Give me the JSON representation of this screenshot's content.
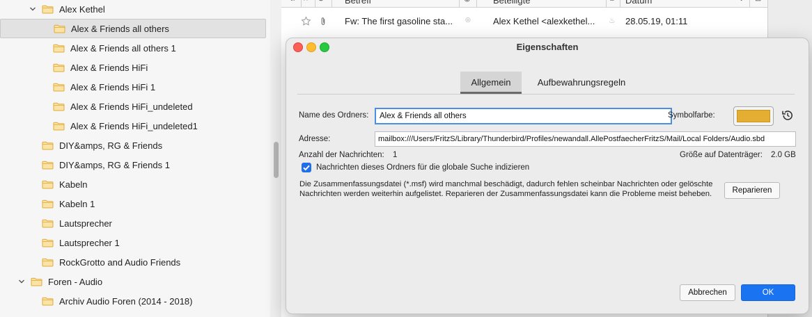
{
  "sidebar": {
    "items": [
      {
        "label": "Alex Kethel",
        "level": 1,
        "expanded": true,
        "selected": false
      },
      {
        "label": "Alex & Friends all others",
        "level": 2,
        "selected": true
      },
      {
        "label": "Alex & Friends all others 1",
        "level": 2
      },
      {
        "label": "Alex & Friends HiFi",
        "level": 2
      },
      {
        "label": "Alex & Friends HiFi 1",
        "level": 2
      },
      {
        "label": "Alex & Friends HiFi_undeleted",
        "level": 2
      },
      {
        "label": "Alex & Friends HiFi_undeleted1",
        "level": 2
      },
      {
        "label": "DIY&amps, RG & Friends",
        "level": 1
      },
      {
        "label": "DIY&amps, RG & Friends 1",
        "level": 1
      },
      {
        "label": "Kabeln",
        "level": 1
      },
      {
        "label": "Kabeln 1",
        "level": 1
      },
      {
        "label": "Lautsprecher",
        "level": 1
      },
      {
        "label": "Lautsprecher 1",
        "level": 1
      },
      {
        "label": "RockGrotto and Audio Friends",
        "level": 1
      },
      {
        "label": "Foren - Audio",
        "level": 0,
        "expanded": true
      },
      {
        "label": "Archiv Audio Foren (2014 - 2018)",
        "level": 1
      }
    ]
  },
  "message_list": {
    "columns": {
      "subject": "Betreff",
      "participants": "Beteiligte",
      "date": "Datum"
    },
    "row": {
      "subject": "Fw: The first gasoline sta...",
      "participants": "Alex Kethel <alexkethel...",
      "date": "28.05.19, 01:11"
    }
  },
  "dialog": {
    "title": "Eigenschaften",
    "tabs": {
      "general": "Allgemein",
      "retention": "Aufbewahrungsregeln"
    },
    "folder_name_label": "Name des Ordners:",
    "folder_name_value": "Alex & Friends all others",
    "symbol_color_label": "Symbolfarbe:",
    "symbol_color": "#e3ae32",
    "address_label": "Adresse:",
    "address_value": "mailbox:///Users/FritzS/Library/Thunderbird/Profiles/newandall.AllePostfaecherFritzS/Mail/Local Folders/Audio.sbd",
    "message_count_label": "Anzahl der Nachrichten:",
    "message_count": "1",
    "disk_size_label": "Größe auf Datenträger:",
    "disk_size": "2.0 GB",
    "index_checkbox_label": "Nachrichten dieses Ordners für die globale Suche indizieren",
    "index_checked": true,
    "summary_text": "Die Zusammenfassungsdatei (*.msf) wird manchmal beschädigt, dadurch fehlen scheinbar Nachrichten oder gelöschte Nachrichten werden weiterhin aufgelistet. Reparieren der Zusammenfassungsdatei kann die Probleme meist beheben.",
    "repair_button": "Reparieren",
    "cancel_button": "Abbrechen",
    "ok_button": "OK"
  },
  "colors": {
    "accent": "#1a73f0",
    "folder": "#f2c04a",
    "selection": "#e2e2e2"
  }
}
